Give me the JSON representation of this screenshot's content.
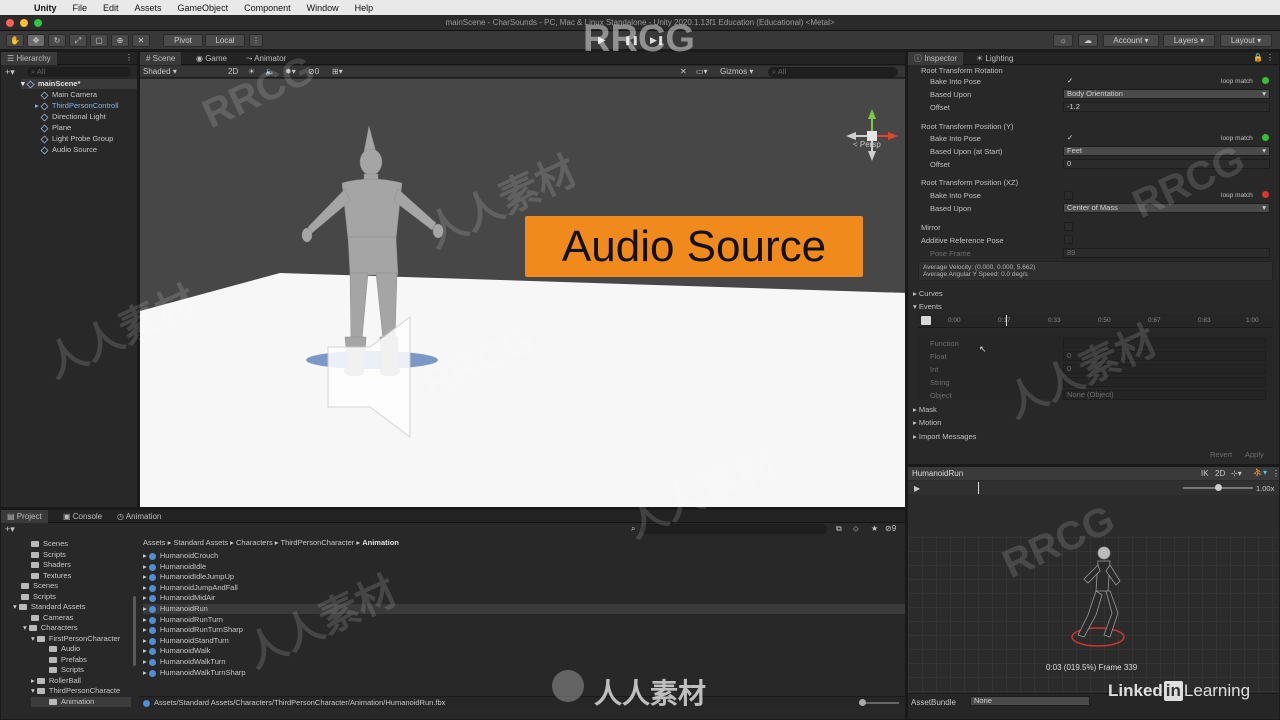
{
  "menubar": {
    "app": "Unity",
    "items": [
      "File",
      "Edit",
      "Assets",
      "GameObject",
      "Component",
      "Window",
      "Help"
    ]
  },
  "window": {
    "title": "mainScene - CharSounds - PC, Mac & Linux Standalone - Unity 2020.1.13f1 Education (Educational) <Metal>"
  },
  "toolbar": {
    "pivot": "Pivot",
    "local": "Local",
    "account": "Account",
    "layers": "Layers",
    "layout": "Layout"
  },
  "hierarchy": {
    "tab": "Hierarchy",
    "search_placeholder": "All",
    "scene": "mainScene*",
    "items": [
      "Main Camera",
      "ThirdPersonControll",
      "Directional Light",
      "Plane",
      "Light Probe Group",
      "Audio Source"
    ]
  },
  "scene_view": {
    "tabs": [
      "Scene",
      "Game",
      "Animator"
    ],
    "shading": "Shaded",
    "mode_2d": "2D",
    "gizmos": "Gizmos",
    "gizmo_search": "All",
    "persp": "< Persp",
    "overlay_label": "Audio Source"
  },
  "inspector": {
    "tabs": [
      "Inspector",
      "Lighting"
    ],
    "root_rotation": {
      "header": "Root Transform Rotation",
      "bake_label": "Bake Into Pose",
      "based_label": "Based Upon",
      "based_value": "Body Orientation",
      "offset_label": "Offset",
      "offset_value": "-1.2",
      "loop": "loop match"
    },
    "root_pos_y": {
      "header": "Root Transform Position (Y)",
      "bake_label": "Bake Into Pose",
      "based_label": "Based Upon (at Start)",
      "based_value": "Feet",
      "offset_label": "Offset",
      "offset_value": "0",
      "loop": "loop match"
    },
    "root_pos_xz": {
      "header": "Root Transform Position (XZ)",
      "bake_label": "Bake Into Pose",
      "based_label": "Based Upon",
      "based_value": "Center of Mass",
      "loop": "loop match"
    },
    "mirror": "Mirror",
    "additive": "Additive Reference Pose",
    "pose_frame_label": "Pose Frame",
    "pose_frame_value": "89",
    "avg_velocity": "Average Velocity: (0.000, 0.000, 5.662)",
    "avg_angular": "Average Angular Y Speed: 0.0 deg/s",
    "sections": [
      "Curves",
      "Events",
      "Mask",
      "Motion",
      "Import Messages"
    ],
    "timeline_ticks": [
      "0:00",
      "0:17",
      "0:33",
      "0:50",
      "0:67",
      "0:83",
      "1:00"
    ],
    "event": {
      "function": "Function",
      "float": "Float",
      "float_value": "0",
      "int": "Int",
      "int_value": "0",
      "string": "String",
      "object": "Object",
      "object_value": "None (Object)"
    },
    "revert": "Revert",
    "apply": "Apply"
  },
  "preview": {
    "clip": "HumanoidRun",
    "ik": "IK",
    "mode_2d": "2D",
    "speed": "1.00x",
    "frame": "0:03 (019.5%) Frame 339",
    "assetbundle_label": "AssetBundle",
    "assetbundle_value": "None"
  },
  "project": {
    "tabs": [
      "Project",
      "Console",
      "Animation"
    ],
    "count": "9",
    "tree": [
      "Scenes",
      "Scripts",
      "Shaders",
      "Textures",
      "Scenes",
      "Scripts",
      "Standard Assets",
      "Cameras",
      "Characters",
      "FirstPersonCharacter",
      "Audio",
      "Prefabs",
      "Scripts",
      "RollerBall",
      "ThirdPersonCharacte",
      "Animation"
    ],
    "breadcrumb": [
      "Assets",
      "Standard Assets",
      "Characters",
      "ThirdPersonCharacter",
      "Animation"
    ],
    "files": [
      "HumanoidCrouch",
      "HumanoidIdle",
      "HumanoidIdleJumpUp",
      "HumanoidJumpAndFall",
      "HumanoidMidAir",
      "HumanoidRun",
      "HumanoidRunTurn",
      "HumanoidRunTurnSharp",
      "HumanoidStandTurn",
      "HumanoidWalk",
      "HumanoidWalkTurn",
      "HumanoidWalkTurnSharp"
    ],
    "path": "Assets/Standard Assets/Characters/ThirdPersonCharacter/Animation/HumanoidRun.fbx"
  },
  "watermarks": {
    "brand": "RRCG",
    "cn": "人人素材",
    "linkedin_a": "Linked",
    "linkedin_in": "in",
    "linkedin_b": "Learning"
  },
  "colors": {
    "accent_blue": "#3c6fb5",
    "overlay_orange": "#f08a1d",
    "loop_green": "#37c037",
    "loop_red": "#d8362b"
  }
}
